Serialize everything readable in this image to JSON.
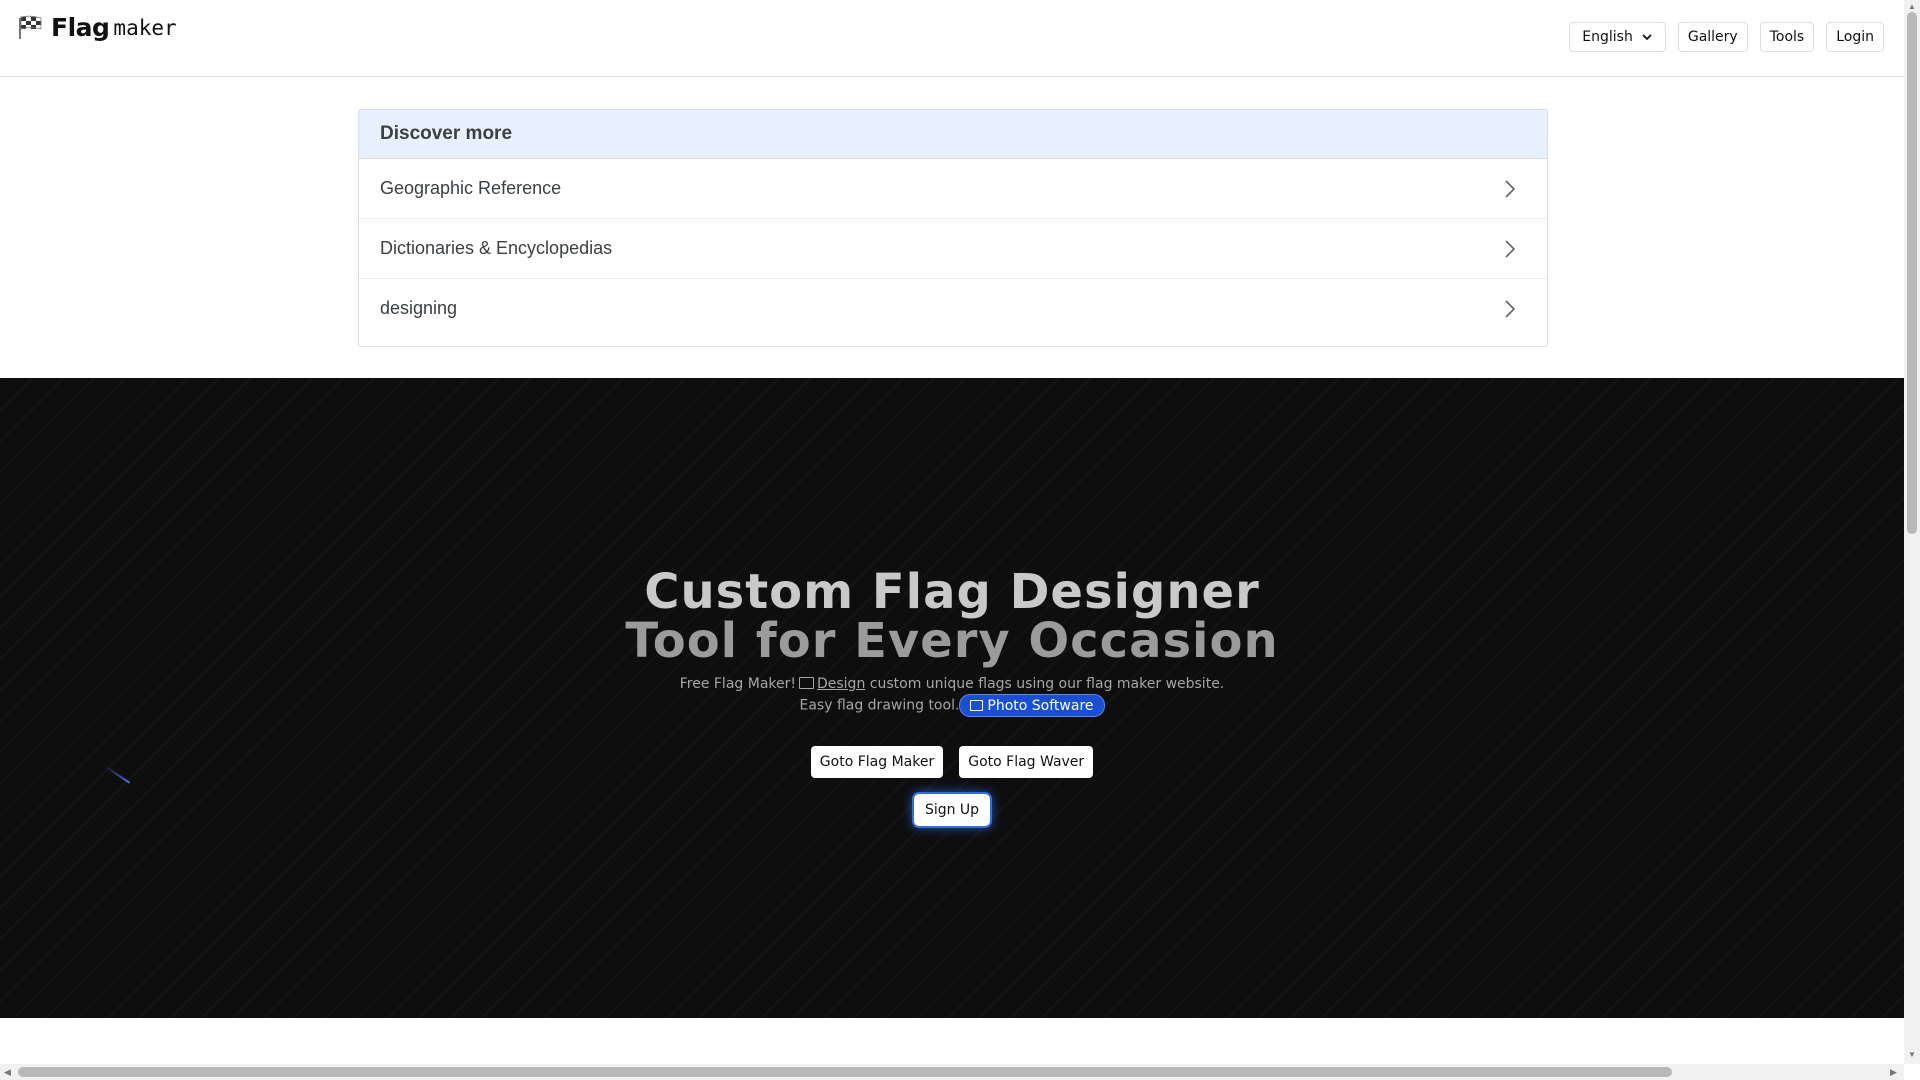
{
  "header": {
    "logo_bold": "Flag",
    "logo_mono": "maker",
    "nav": {
      "language": "English",
      "gallery": "Gallery",
      "tools": "Tools",
      "login": "Login"
    }
  },
  "discover": {
    "title": "Discover more",
    "items": [
      {
        "label": "Geographic Reference"
      },
      {
        "label": "Dictionaries & Encyclopedias"
      },
      {
        "label": "designing"
      }
    ]
  },
  "hero": {
    "title_line1": "Custom Flag Designer",
    "title_line2": "Tool for Every Occasion",
    "subtitle_part1": "Free Flag Maker!",
    "subtitle_link": "Design",
    "subtitle_part2": "custom unique flags using our flag maker website.",
    "subtitle_part3": "Easy flag drawing tool.",
    "pill_label": "Photo Software",
    "btn_maker": "Goto Flag Maker",
    "btn_waver": "Goto Flag Waver",
    "btn_signup": "Sign Up"
  },
  "colors": {
    "hero_bg": "#0e0e0f",
    "pill_bg": "#1a4fd1",
    "discover_head_bg": "#e8f0fd"
  }
}
